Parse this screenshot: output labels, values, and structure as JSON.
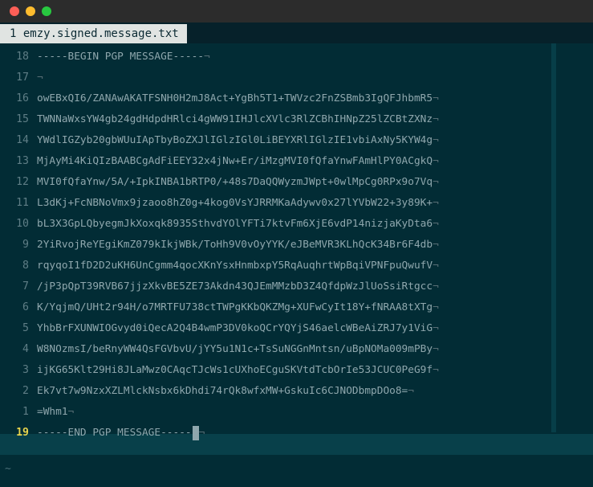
{
  "tab": {
    "label": "1 emzy.signed.message.txt"
  },
  "newline_marker": "¬",
  "filler": "~",
  "lines": [
    {
      "num": "18",
      "text": "-----BEGIN PGP MESSAGE-----"
    },
    {
      "num": "17",
      "text": ""
    },
    {
      "num": "16",
      "text": "owEBxQI6/ZANAwAKATFSNH0H2mJ8Act+YgBh5T1+TWVzc2FnZSBmb3IgQFJhbmR5"
    },
    {
      "num": "15",
      "text": "TWNNaWxsYW4gb24gdHdpdHRlci4gWW91IHJlcXVlc3RlZCBhIHNpZ25lZCBtZXNz"
    },
    {
      "num": "14",
      "text": "YWdlIGZyb20gbWUuIApTbyBoZXJlIGlzIGl0LiBEYXRlIGlzIE1vbiAxNy5KYW4g"
    },
    {
      "num": "13",
      "text": "MjAyMi4KiQIzBAABCgAdFiEEY32x4jNw+Er/iMzgMVI0fQfaYnwFAmHlPY0ACgkQ"
    },
    {
      "num": "12",
      "text": "MVI0fQfaYnw/5A/+IpkINBA1bRTP0/+48s7DaQQWyzmJWpt+0wlMpCg0RPx9o7Vq"
    },
    {
      "num": "11",
      "text": "L3dKj+FcNBNoVmx9jzaoo8hZ0g+4kog0VsYJRRMKaAdywv0x27lYVbW22+3y89K+"
    },
    {
      "num": "10",
      "text": "bL3X3GpLQbyegmJkXoxqk8935SthvdYOlYFTi7ktvFm6XjE6vdP14nizjaKyDta6"
    },
    {
      "num": "9",
      "text": "2YiRvojReYEgiKmZ079kIkjWBk/ToHh9V0vOyYYK/eJBeMVR3KLhQcK34Br6F4db"
    },
    {
      "num": "8",
      "text": "rqyqoI1fD2D2uKH6UnCgmm4qocXKnYsxHnmbxpY5RqAuqhrtWpBqiVPNFpuQwufV"
    },
    {
      "num": "7",
      "text": "/jP3pQpT39RVB67jjzXkvBE5ZE73Akdn43QJEmMMzbD3Z4QfdpWzJlUoSsiRtgcc"
    },
    {
      "num": "6",
      "text": "K/YqjmQ/UHt2r94H/o7MRTFU738ctTWPgKKbQKZMg+XUFwCyIt18Y+fNRAA8tXTg"
    },
    {
      "num": "5",
      "text": "YhbBrFXUNWIOGvyd0iQecA2Q4B4wmP3DV0koQCrYQYjS46aelcWBeAiZRJ7y1ViG"
    },
    {
      "num": "4",
      "text": "W8NOzmsI/beRnyWW4QsFGVbvU/jYY5u1N1c+TsSuNGGnMntsn/uBpNOMa009mPBy"
    },
    {
      "num": "3",
      "text": "ijKG65Klt29Hi8JLaMwz0CAqcTJcWs1cUXhoECguSKVtdTcbOrIe53JCUC0PeG9f"
    },
    {
      "num": "2",
      "text": "Ek7vt7w9NzxXZLMlckNsbx6kDhdi74rQk8wfxMW+GskuIc6CJNODbmpDOo8="
    },
    {
      "num": "1",
      "text": "=Whm1"
    },
    {
      "num": "19",
      "text": "-----END PGP MESSAGE-----",
      "current": true
    }
  ]
}
